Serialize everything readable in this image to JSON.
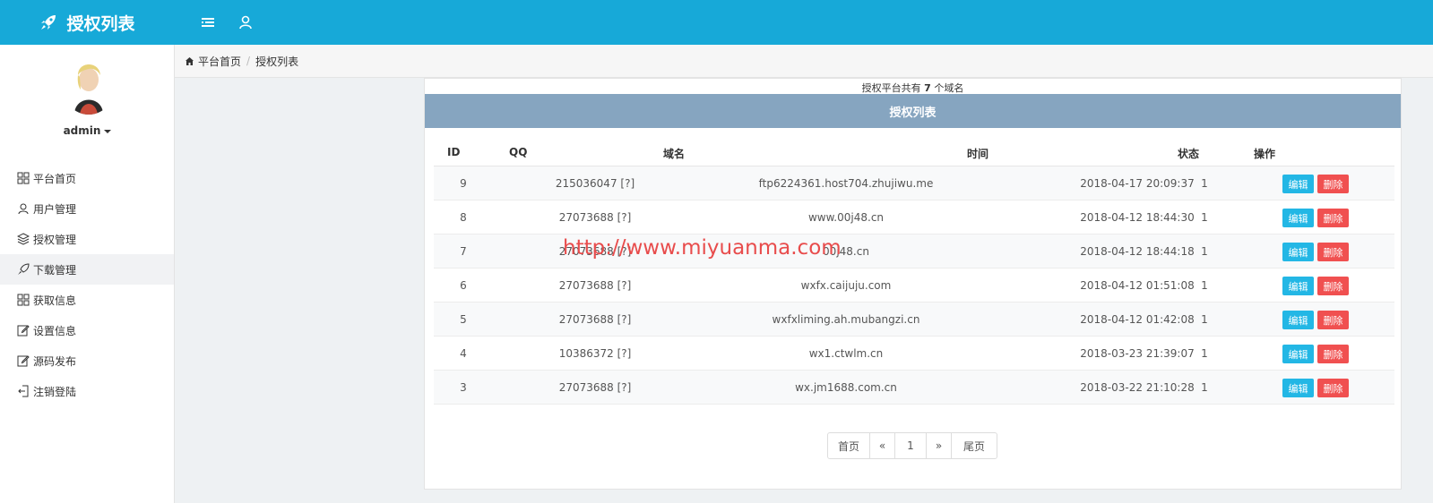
{
  "header": {
    "title": "授权列表"
  },
  "user": {
    "name": "admin"
  },
  "sidebar": {
    "items": [
      {
        "label": "平台首页",
        "icon": "grid-icon"
      },
      {
        "label": "用户管理",
        "icon": "user-icon"
      },
      {
        "label": "授权管理",
        "icon": "layers-icon"
      },
      {
        "label": "下载管理",
        "icon": "rocket-icon"
      },
      {
        "label": "获取信息",
        "icon": "grid-icon"
      },
      {
        "label": "设置信息",
        "icon": "edit-icon"
      },
      {
        "label": "源码发布",
        "icon": "edit-icon"
      },
      {
        "label": "注销登陆",
        "icon": "logout-icon"
      }
    ]
  },
  "breadcrumb": {
    "home": "平台首页",
    "current": "授权列表"
  },
  "panel": {
    "summary_prefix": "授权平台共有",
    "summary_count": "7",
    "summary_suffix": "个域名",
    "title": "授权列表"
  },
  "table": {
    "columns": {
      "id": "ID",
      "qq": "QQ",
      "domain": "域名",
      "time": "时间",
      "status": "状态",
      "action": "操作"
    },
    "rows": [
      {
        "id": "9",
        "qq": "215036047 [?]",
        "domain": "ftp6224361.host704.zhujiwu.me",
        "time": "2018-04-17 20:09:37",
        "status": "1"
      },
      {
        "id": "8",
        "qq": "27073688 [?]",
        "domain": "www.00j48.cn",
        "time": "2018-04-12 18:44:30",
        "status": "1"
      },
      {
        "id": "7",
        "qq": "27073688 [?]",
        "domain": "00j48.cn",
        "time": "2018-04-12 18:44:18",
        "status": "1"
      },
      {
        "id": "6",
        "qq": "27073688 [?]",
        "domain": "wxfx.caijuju.com",
        "time": "2018-04-12 01:51:08",
        "status": "1"
      },
      {
        "id": "5",
        "qq": "27073688 [?]",
        "domain": "wxfxliming.ah.mubangzi.cn",
        "time": "2018-04-12 01:42:08",
        "status": "1"
      },
      {
        "id": "4",
        "qq": "10386372 [?]",
        "domain": "wx1.ctwlm.cn",
        "time": "2018-03-23 21:39:07",
        "status": "1"
      },
      {
        "id": "3",
        "qq": "27073688 [?]",
        "domain": "wx.jm1688.com.cn",
        "time": "2018-03-22 21:10:28",
        "status": "1"
      }
    ],
    "edit_label": "编辑",
    "delete_label": "删除"
  },
  "pagination": {
    "first": "首页",
    "prev": "«",
    "current": "1",
    "next": "»",
    "last": "尾页"
  },
  "watermark": "http://www.miyuanma.com",
  "colors": {
    "topbar": "#17a9d8",
    "panel_header": "#86a5c0",
    "edit": "#23b7e5",
    "delete": "#f05050"
  }
}
